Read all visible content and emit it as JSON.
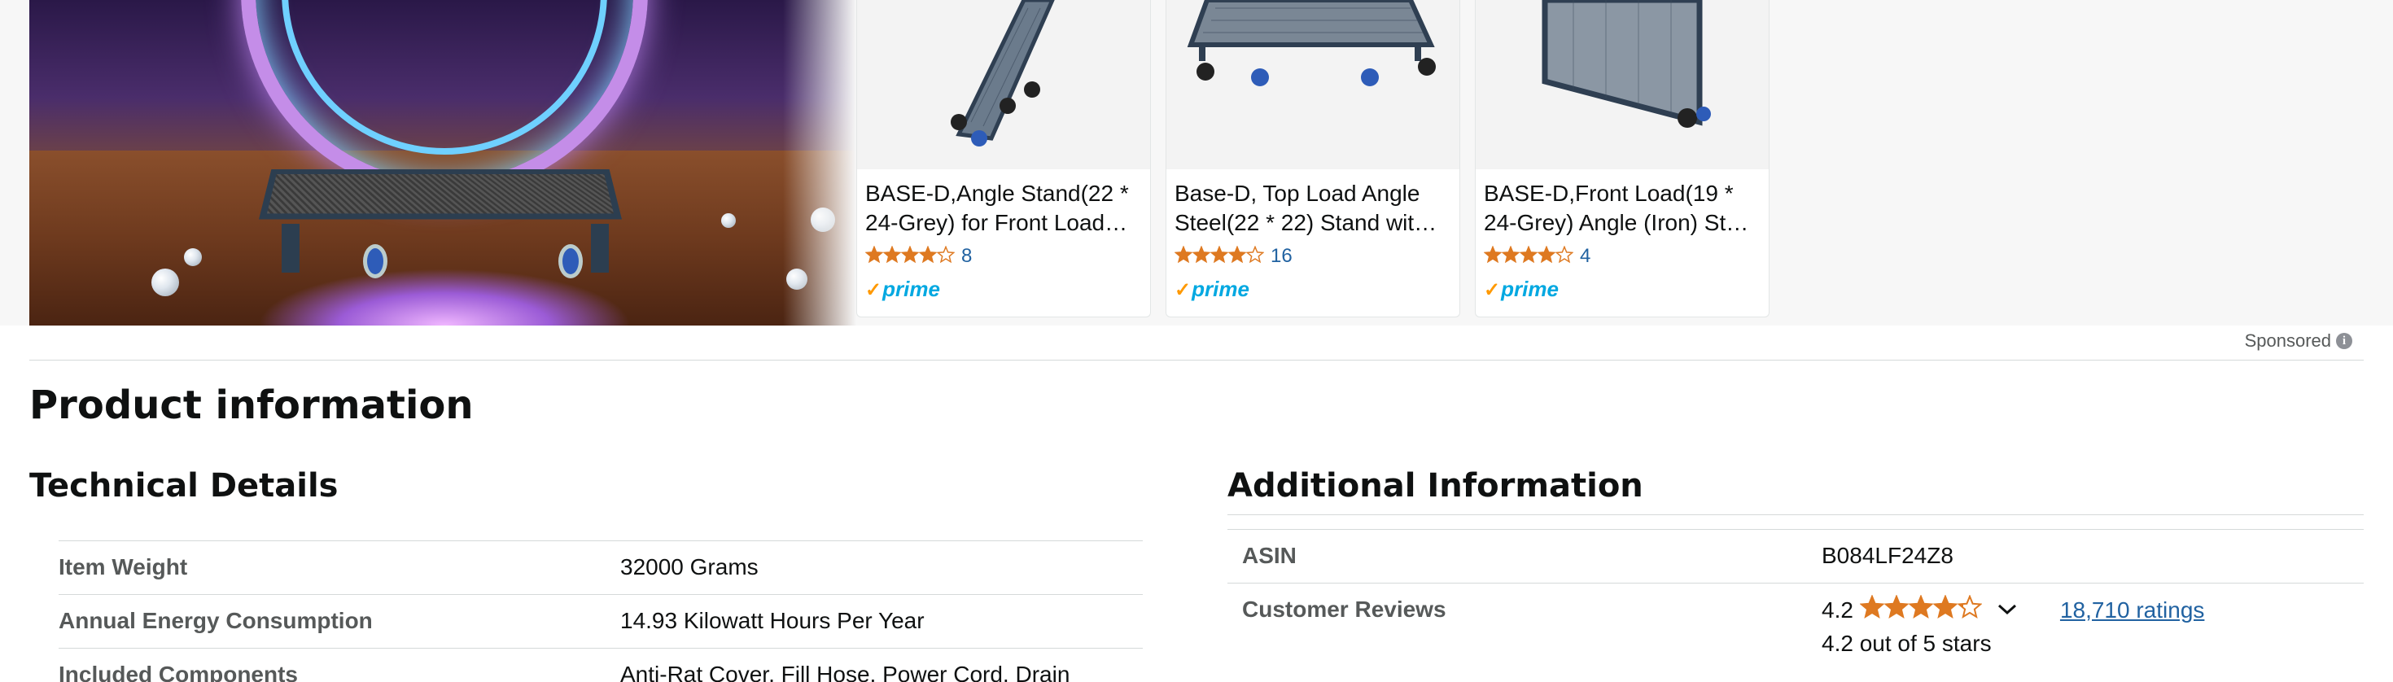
{
  "colors": {
    "accent_star": "#de7921",
    "link": "#2162a1",
    "prime": "#00a8e1",
    "prime_check": "#ff9900",
    "text": "#0f1111",
    "muted": "#565959"
  },
  "sponsored_carousel": {
    "cards": [
      {
        "title": "BASE-D,Angle Stand(22 * 24-Grey) for Front Load…",
        "rating": 4,
        "rating_count": "8",
        "prime": "prime"
      },
      {
        "title": "Base-D, Top Load Angle Steel(22 * 22) Stand wit…",
        "rating": 4,
        "rating_count": "16",
        "prime": "prime"
      },
      {
        "title": "BASE-D,Front Load(19 * 24-Grey) Angle (Iron) St…",
        "rating": 4,
        "rating_count": "4",
        "prime": "prime"
      }
    ],
    "sponsored_label": "Sponsored",
    "info_icon": "i"
  },
  "product_information": {
    "title": "Product information",
    "technical_details": {
      "title": "Technical Details",
      "rows": [
        {
          "key": "Item Weight",
          "value": "32000 Grams"
        },
        {
          "key": "Annual Energy Consumption",
          "value": "14.93 Kilowatt Hours Per Year"
        },
        {
          "key": "Included Components",
          "value": "Anti-Rat Cover, Fill Hose, Power Cord, Drain"
        }
      ]
    },
    "additional_information": {
      "title": "Additional Information",
      "asin_label": "ASIN",
      "asin_value": "B084LF24Z8",
      "reviews_label": "Customer Reviews",
      "rating_value": "4.2",
      "rating": 4.2,
      "ratings_link": "18,710 ratings",
      "out_of": "4.2 out of 5 stars"
    }
  }
}
